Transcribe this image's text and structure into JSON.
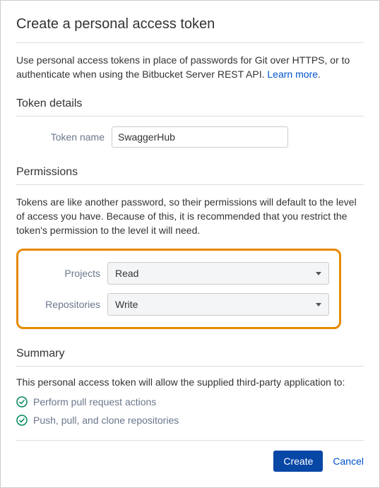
{
  "title": "Create a personal access token",
  "intro_text": "Use personal access tokens in place of passwords for Git over HTTPS, or to authenticate when using the Bitbucket Server REST API. ",
  "learn_more": "Learn more",
  "period": ".",
  "token_details": {
    "heading": "Token details",
    "name_label": "Token name",
    "name_value": "SwaggerHub"
  },
  "permissions": {
    "heading": "Permissions",
    "description": "Tokens are like another password, so their permissions will default to the level of access you have. Because of this, it is recommended that you restrict the token's permission to the level it will need.",
    "projects_label": "Projects",
    "projects_value": "Read",
    "repos_label": "Repositories",
    "repos_value": "Write"
  },
  "summary": {
    "heading": "Summary",
    "lead": "This personal access token will allow the supplied third-party application to:",
    "items": [
      "Perform pull request actions",
      "Push, pull, and clone repositories"
    ]
  },
  "actions": {
    "create": "Create",
    "cancel": "Cancel"
  }
}
